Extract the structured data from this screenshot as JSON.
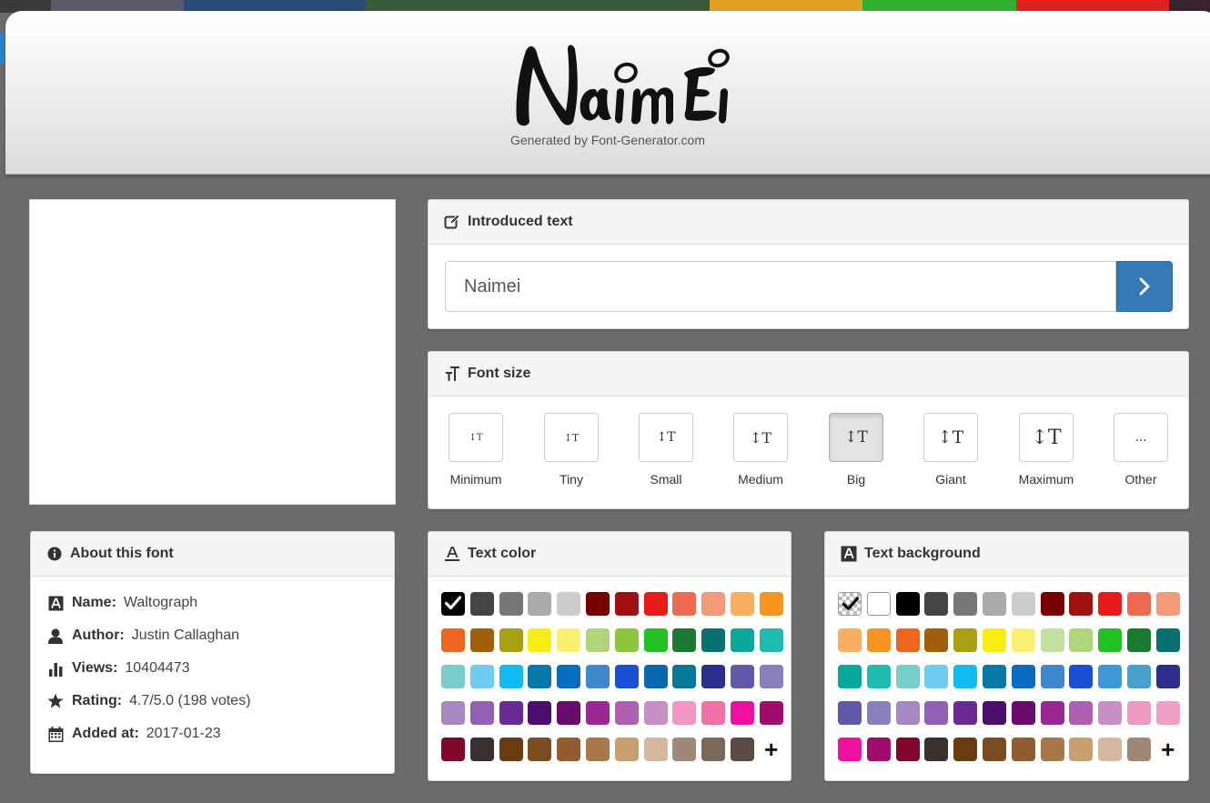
{
  "top_stripe_colors": [
    "#3a3a3a",
    "#5a5a6a",
    "#2a4a7a",
    "#3a5a3a",
    "#e0a020",
    "#30b030",
    "#e02020",
    "#3a2030"
  ],
  "header": {
    "logo_text": "Naimei",
    "generated_by": "Generated by Font-Generator.com"
  },
  "introduced_text": {
    "title": "Introduced text",
    "value": "Naimei",
    "icon": "edit-icon"
  },
  "font_size": {
    "title": "Font size",
    "icon": "text-height-icon",
    "options": [
      {
        "label": "Minimum",
        "glyph": "↕T"
      },
      {
        "label": "Tiny",
        "glyph": "↕T"
      },
      {
        "label": "Small",
        "glyph": "↕T"
      },
      {
        "label": "Medium",
        "glyph": "↕T"
      },
      {
        "label": "Big",
        "glyph": "↕T"
      },
      {
        "label": "Giant",
        "glyph": "↕T"
      },
      {
        "label": "Maximum",
        "glyph": "↕T"
      },
      {
        "label": "Other",
        "glyph": "..."
      }
    ],
    "selected": "Big"
  },
  "about": {
    "title": "About this font",
    "rows": [
      {
        "label": "Name:",
        "value": "Waltograph",
        "icon": "font-icon"
      },
      {
        "label": "Author:",
        "value": "Justin Callaghan",
        "icon": "user-icon"
      },
      {
        "label": "Views:",
        "value": "10404473",
        "icon": "bar-chart-icon"
      },
      {
        "label": "Rating:",
        "value": "4.7/5.0 (198 votes)",
        "icon": "star-icon"
      },
      {
        "label": "Added at:",
        "value": "2017-01-23",
        "icon": "calendar-icon"
      }
    ]
  },
  "text_color": {
    "title": "Text color",
    "icon": "text-color-icon",
    "colors": [
      "#000000",
      "#444444",
      "#777777",
      "#aaaaaa",
      "#cccccc",
      "#7a0000",
      "#a01010",
      "#e81a1a",
      "#ee6a50",
      "#f29a7a",
      "#f8b060",
      "#f49520",
      "#ee6520",
      "#a0600a",
      "#a8a010",
      "#f8ec10",
      "#f8f070",
      "#b0d478",
      "#8cc43c",
      "#22c022",
      "#1a7a30",
      "#087070",
      "#08a89a",
      "#20bcb4",
      "#7accc8",
      "#70ccf0",
      "#10bcf0",
      "#0878a8",
      "#0a6cbc",
      "#4088cc",
      "#1c50d4",
      "#0a68b0",
      "#08789a",
      "#2c308c",
      "#6058a8",
      "#8880bc",
      "#a888c4",
      "#9060b4",
      "#6a2a94",
      "#4c0e6c",
      "#6a0a6a",
      "#9a2894",
      "#b060b0",
      "#c890c4",
      "#f098c4",
      "#f070a8",
      "#f010a0",
      "#a00c6c",
      "#80062a",
      "#3a3030",
      "#6a3a10",
      "#7a4c20",
      "#905c30",
      "#a87848",
      "#c8a070",
      "#d4b8a0",
      "#a08878",
      "#7a6858",
      "#5a4c44"
    ],
    "selected": "#000000",
    "add_label": "+"
  },
  "text_background": {
    "title": "Text background",
    "icon": "text-background-icon",
    "colors": [
      "transparent",
      "#ffffff",
      "#000000",
      "#444444",
      "#777777",
      "#aaaaaa",
      "#cccccc",
      "#7a0000",
      "#a01010",
      "#e81a1a",
      "#ee6a50",
      "#f29a7a",
      "#f8b060",
      "#f49520",
      "#ee6520",
      "#a0600a",
      "#a8a010",
      "#f8ec10",
      "#f8f070",
      "#c4e0a0",
      "#b0d478",
      "#22c022",
      "#1a7a30",
      "#087070",
      "#08a89a",
      "#20bcb4",
      "#7accc8",
      "#70ccf0",
      "#10bcf0",
      "#0878a8",
      "#0a6cbc",
      "#4088cc",
      "#1c50d4",
      "#3c98d8",
      "#48a0cc",
      "#2c308c",
      "#6058a8",
      "#8880bc",
      "#a888c4",
      "#9060b4",
      "#6a2a94",
      "#4c0e6c",
      "#6a0a6a",
      "#9a2894",
      "#b060b0",
      "#c890c4",
      "#f098c4",
      "#f0a0c8",
      "#f010a0",
      "#a00c6c",
      "#80062a",
      "#3a3030",
      "#6a3a10",
      "#7a4c20",
      "#905c30",
      "#a87848",
      "#c8a070",
      "#d4b8a0",
      "#a08878"
    ],
    "selected": "transparent",
    "add_label": "+"
  }
}
